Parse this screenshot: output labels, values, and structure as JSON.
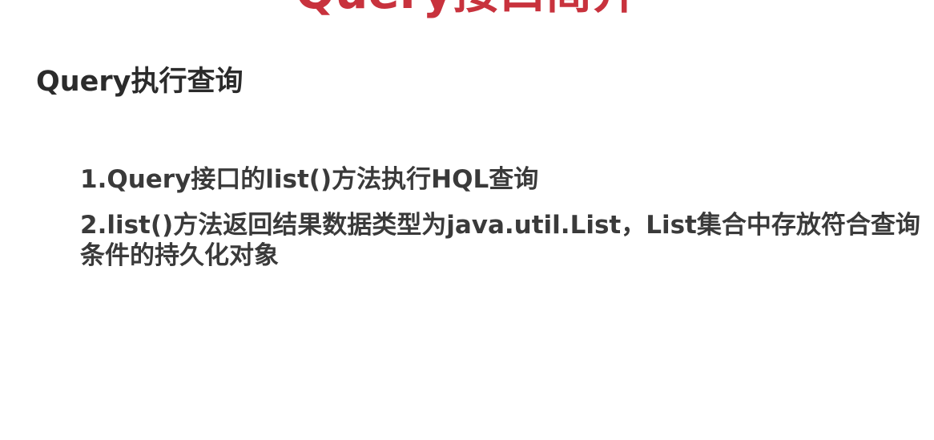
{
  "slide": {
    "title": "Query接口简介",
    "section_heading": "Query执行查询",
    "points": [
      "1.Query接口的list()方法执行HQL查询",
      "2.list()方法返回结果数据类型为java.util.List，List集合中存放符合查询条件的持久化对象"
    ],
    "colors": {
      "title": "#c8323d",
      "heading": "#2b2b2b",
      "body_text": "#3a3a3a",
      "background": "#ffffff"
    }
  }
}
